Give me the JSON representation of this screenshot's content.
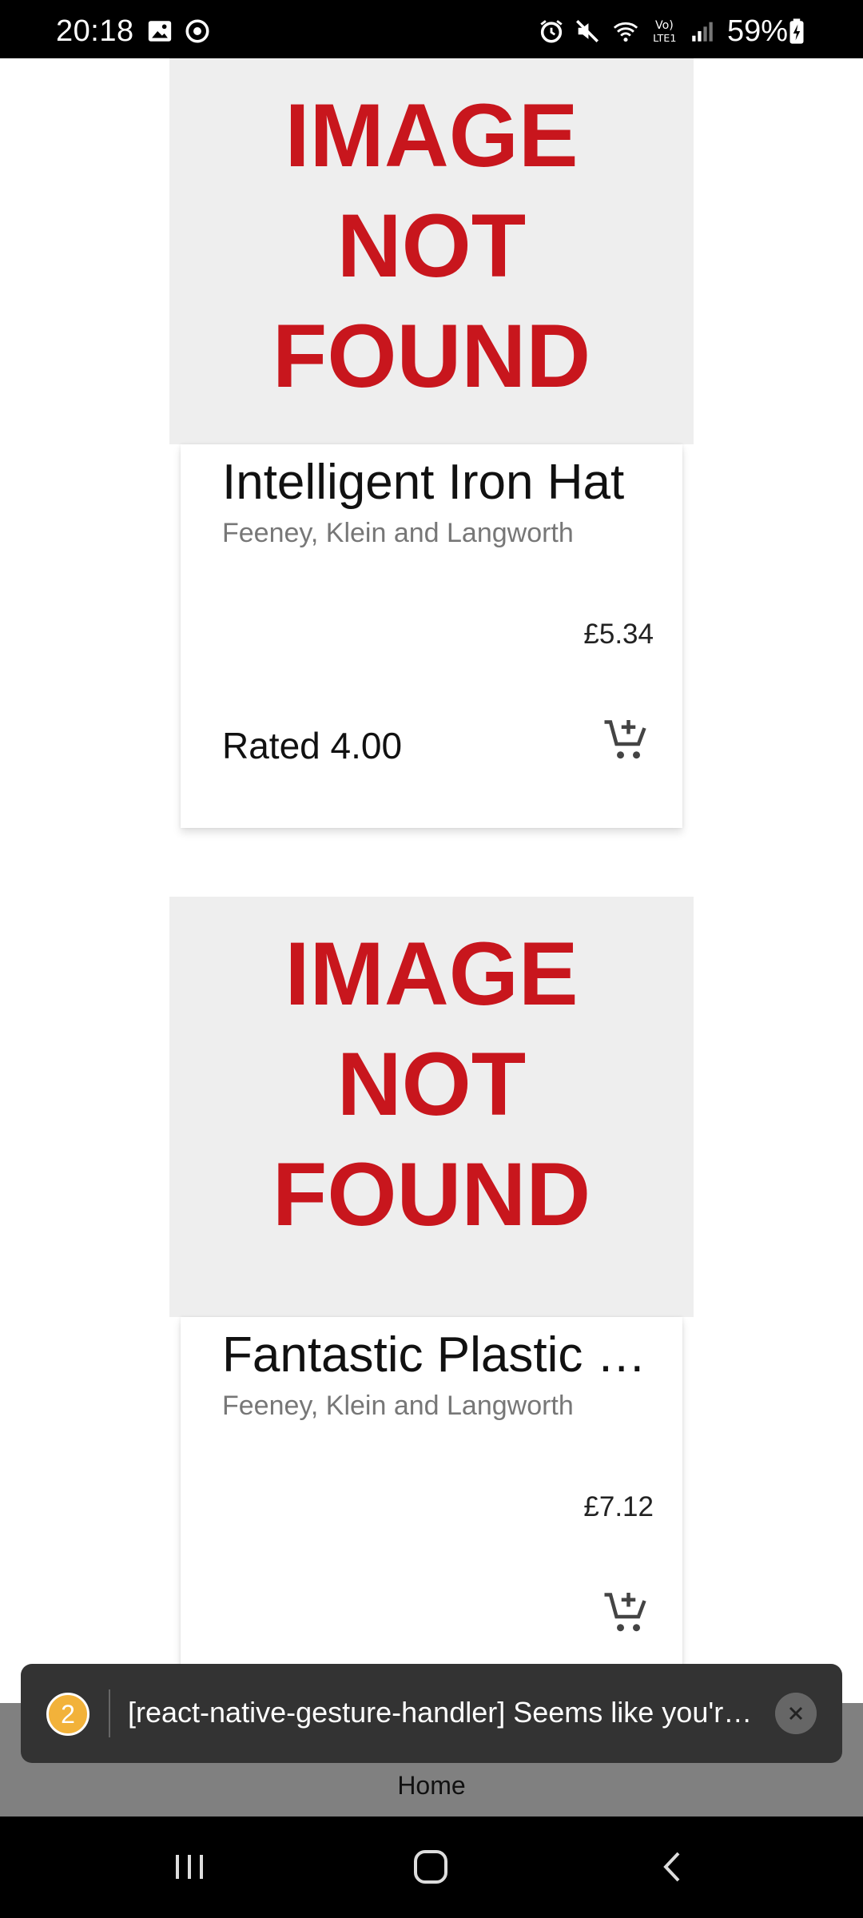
{
  "status_bar": {
    "time": "20:18",
    "battery": "59%",
    "icons": [
      "gallery-icon",
      "sync-icon",
      "alarm-icon",
      "mute-icon",
      "wifi-icon",
      "volte-icon",
      "signal-icon",
      "battery-charging-icon"
    ]
  },
  "products": [
    {
      "image_text": [
        "IMAGE",
        "NOT",
        "FOUND"
      ],
      "title": "Intelligent Iron Hat",
      "brand": "Feeney, Klein and Langworth",
      "price": "£5.34",
      "rating": "Rated 4.00"
    },
    {
      "image_text": [
        "IMAGE",
        "NOT",
        "FOUND"
      ],
      "title": "Fantastic Plastic S…",
      "brand": "Feeney, Klein and Langworth",
      "price": "£7.12",
      "rating": ""
    }
  ],
  "toast": {
    "count": "2",
    "message": "[react-native-gesture-handler] Seems like you'r…"
  },
  "tab_bar": {
    "home_label": "Home"
  },
  "colors": {
    "image_placeholder_bg": "#eeeeee",
    "image_placeholder_text": "#c8161d",
    "toast_bg": "#333333",
    "toast_badge": "#f2b23a",
    "tab_bar_bg": "#808080"
  }
}
